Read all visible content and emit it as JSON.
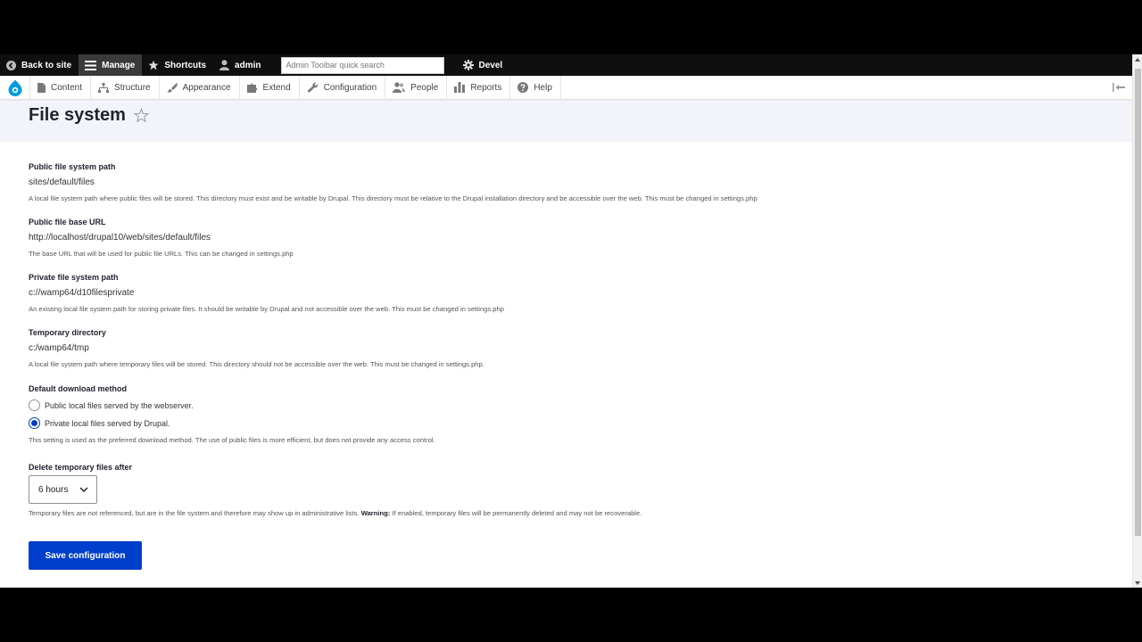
{
  "toolbar": {
    "back_to_site": "Back to site",
    "manage": "Manage",
    "shortcuts": "Shortcuts",
    "user": "admin",
    "search_placeholder": "Admin Toolbar quick search",
    "devel": "Devel"
  },
  "tray": {
    "items": [
      "Content",
      "Structure",
      "Appearance",
      "Extend",
      "Configuration",
      "People",
      "Reports",
      "Help"
    ]
  },
  "page": {
    "title": "File system"
  },
  "form": {
    "public_path": {
      "label": "Public file system path",
      "value": "sites/default/files",
      "description": "A local file system path where public files will be stored. This directory must exist and be writable by Drupal. This directory must be relative to the Drupal installation directory and be accessible over the web. This must be changed in settings.php"
    },
    "public_url": {
      "label": "Public file base URL",
      "value": "http://localhost/drupal10/web/sites/default/files",
      "description": "The base URL that will be used for public file URLs. This can be changed in settings.php"
    },
    "private_path": {
      "label": "Private file system path",
      "value": "c://wamp64/d10filesprivate",
      "description": "An existing local file system path for storing private files. It should be writable by Drupal and not accessible over the web. This must be changed in settings.php"
    },
    "temp_dir": {
      "label": "Temporary directory",
      "value": "c:/wamp64/tmp",
      "description": "A local file system path where temporary files will be stored. This directory should not be accessible over the web. This must be changed in settings.php."
    },
    "download_method": {
      "label": "Default download method",
      "options": [
        "Public local files served by the webserver.",
        "Private local files served by Drupal."
      ],
      "selected_index": 1,
      "description": "This setting is used as the preferred download method. The use of public files is more efficient, but does not provide any access control."
    },
    "delete_temp": {
      "label": "Delete temporary files after",
      "selected": "6 hours",
      "description_prefix": "Temporary files are not referenced, but are in the file system and therefore may show up in administrative lists.",
      "description_warning": "Warning:",
      "description_suffix": "If enabled, temporary files will be permanently deleted and may not be recoverable."
    },
    "save_label": "Save configuration"
  },
  "colors": {
    "accent": "#003ecc",
    "admin_bar": "#0f0f0f",
    "header_bg": "#f3f4f9"
  }
}
